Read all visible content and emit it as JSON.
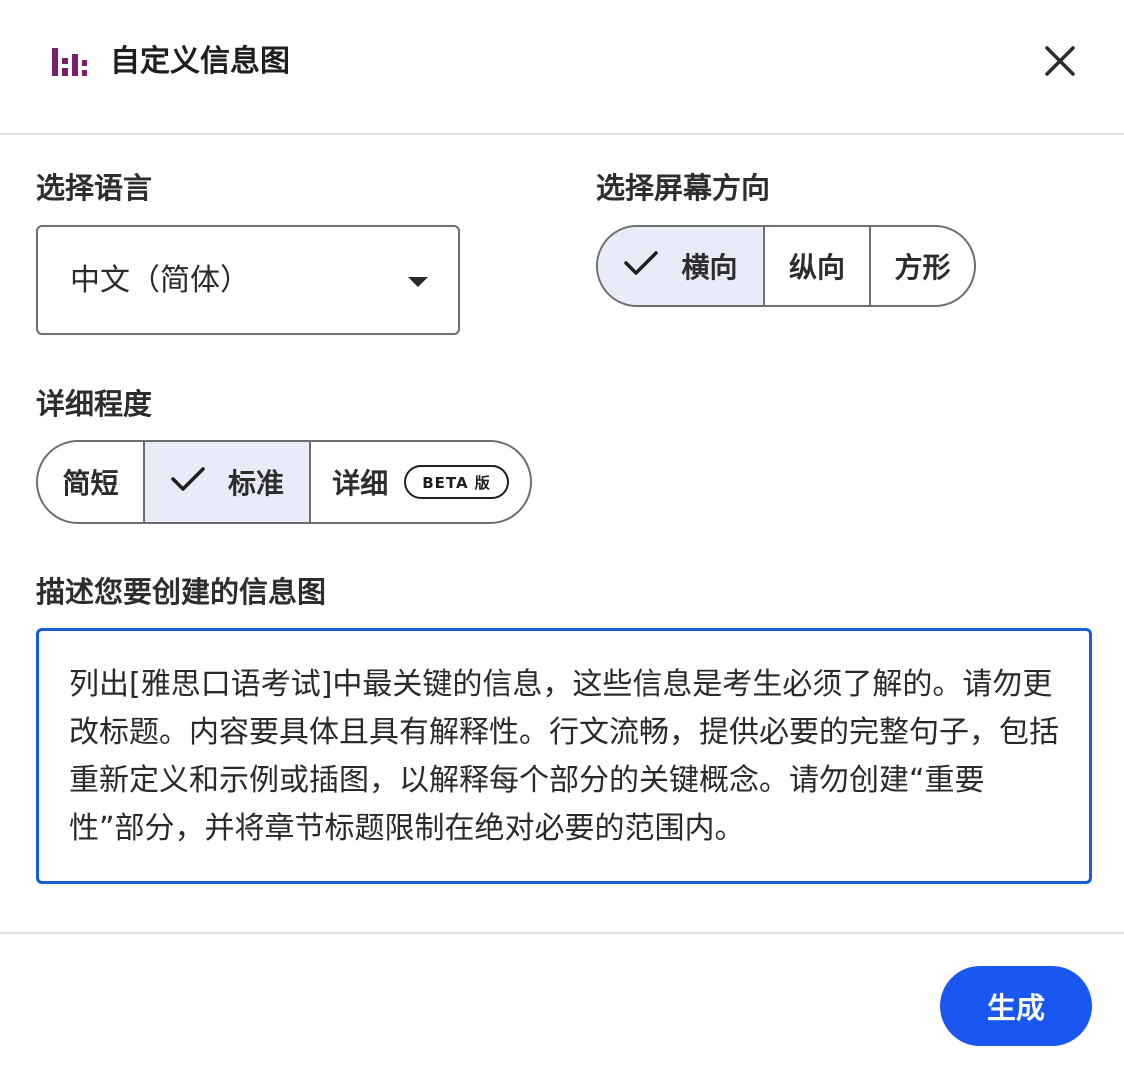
{
  "header": {
    "title": "自定义信息图",
    "app_icon": "infographic-bars-icon",
    "close_icon": "close-icon"
  },
  "language": {
    "label": "选择语言",
    "selected": "中文（简体）",
    "caret_icon": "caret-down-icon"
  },
  "orientation": {
    "label": "选择屏幕方向",
    "options": [
      {
        "label": "横向",
        "selected": true
      },
      {
        "label": "纵向",
        "selected": false
      },
      {
        "label": "方形",
        "selected": false
      }
    ]
  },
  "detail": {
    "label": "详细程度",
    "options": [
      {
        "label": "简短",
        "selected": false
      },
      {
        "label": "标准",
        "selected": true
      },
      {
        "label": "详细",
        "selected": false,
        "badge": "BETA 版"
      }
    ]
  },
  "description": {
    "label": "描述您要创建的信息图",
    "value": "列出[雅思口语考试]中最关键的信息，这些信息是考生必须了解的。请勿更改标题。内容要具体且具有解释性。行文流畅，提供必要的完整句子，包括重新定义和示例或插图，以解释每个部分的关键概念。请勿创建“重要性”部分，并将章节标题限制在绝对必要的范围内。"
  },
  "footer": {
    "generate_label": "生成"
  },
  "colors": {
    "accent": "#1a56f0",
    "focus_border": "#1a5bd6",
    "icon_purple": "#7a1d6b",
    "selected_bg": "#e8ebf8"
  }
}
